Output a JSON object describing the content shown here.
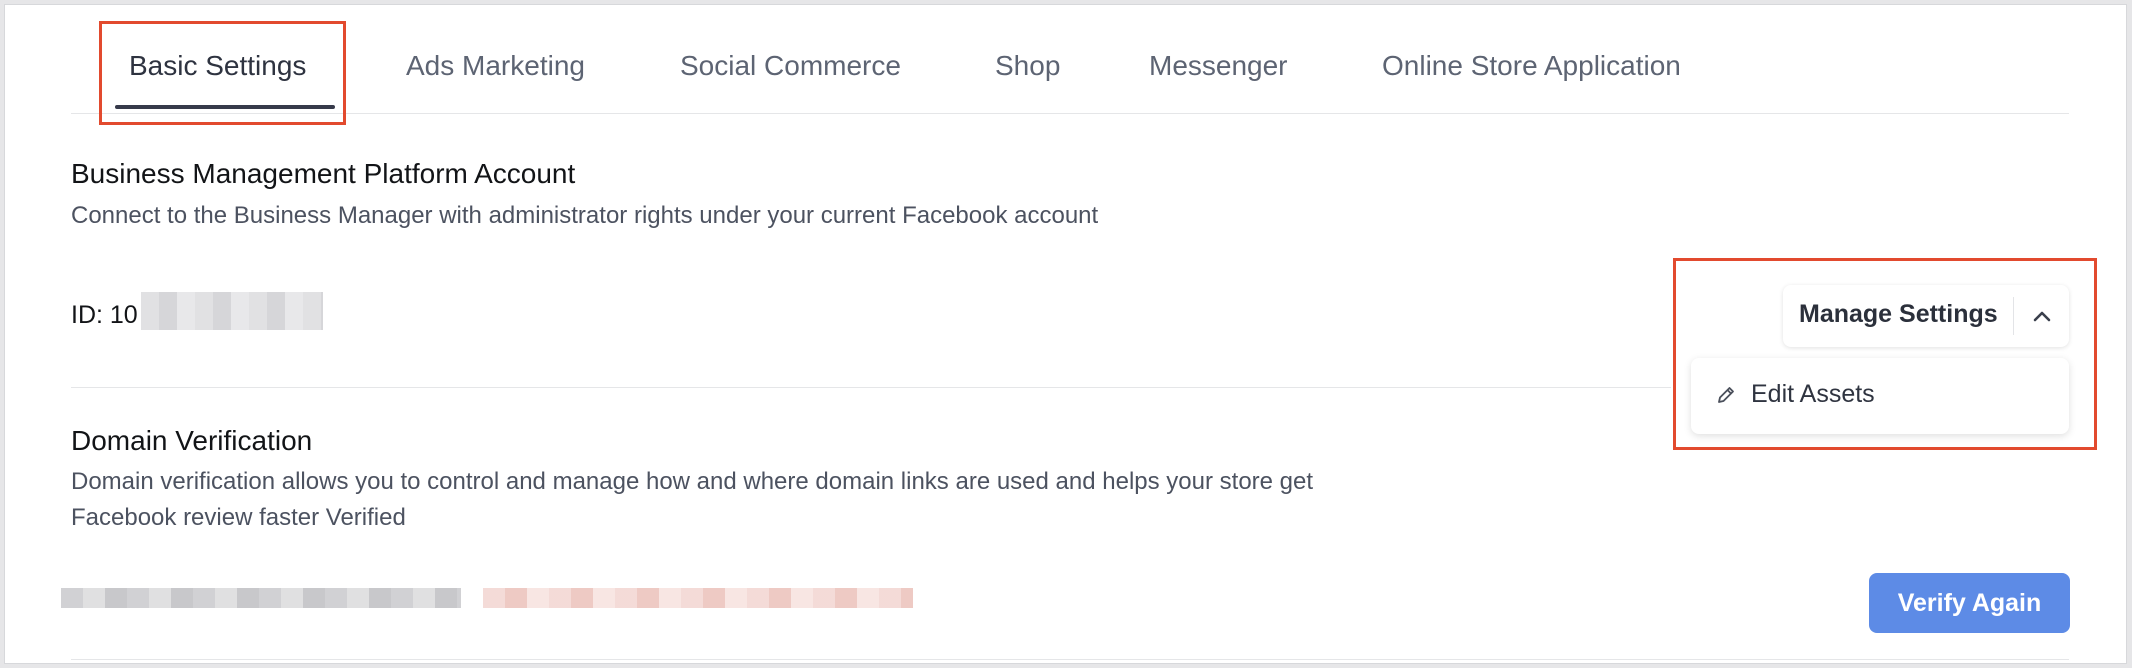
{
  "tabs": [
    {
      "label": "Basic Settings",
      "active": true
    },
    {
      "label": "Ads Marketing"
    },
    {
      "label": "Social Commerce"
    },
    {
      "label": "Shop"
    },
    {
      "label": "Messenger"
    },
    {
      "label": "Online Store Application"
    }
  ],
  "business": {
    "title": "Business Management Platform Account",
    "description": "Connect to the Business Manager with administrator rights under your current Facebook account",
    "id_label": "ID: 10"
  },
  "manage": {
    "label": "Manage Settings",
    "menu": [
      {
        "label": "Edit Assets",
        "icon": "pencil-icon"
      }
    ]
  },
  "domain": {
    "title": "Domain Verification",
    "description_line1": "Domain verification allows you to control and manage how and where domain links are used and helps your store get",
    "description_line2": "Facebook review faster Verified",
    "verify_label": "Verify Again"
  },
  "colors": {
    "highlight": "#e24a2e",
    "primary_button": "#5d8be6",
    "active_tab_underline": "#363a4a"
  }
}
